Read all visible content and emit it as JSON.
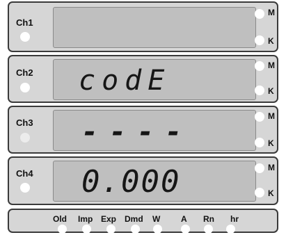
{
  "channels": [
    {
      "label": "Ch1",
      "display": ""
    },
    {
      "label": "Ch2",
      "display": "codE"
    },
    {
      "label": "Ch3",
      "display": "----"
    },
    {
      "label": "Ch4",
      "display": "0.000"
    }
  ],
  "indicators": {
    "upper": "M",
    "lower": "K"
  },
  "bottom_labels": [
    "Old",
    "Imp",
    "Exp",
    "Dmd",
    "W",
    "A",
    "Rn",
    "hr"
  ]
}
